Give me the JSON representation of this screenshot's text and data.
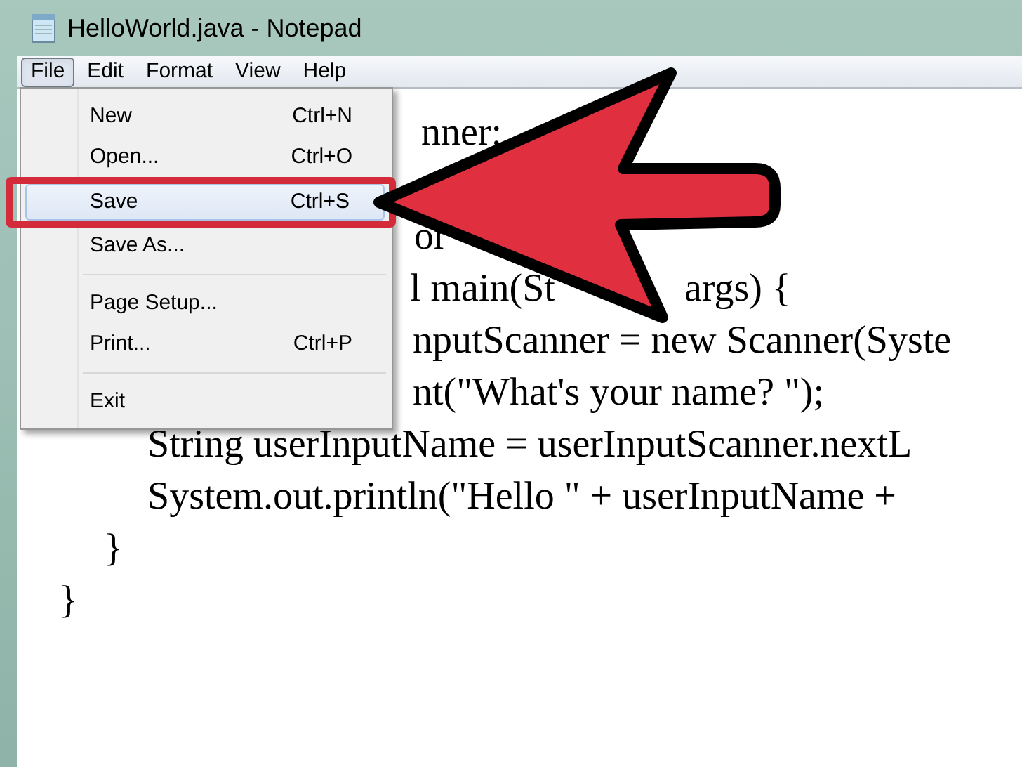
{
  "window": {
    "title": "HelloWorld.java - Notepad"
  },
  "menu_bar": [
    {
      "label": "File",
      "selected": true
    },
    {
      "label": "Edit",
      "selected": false
    },
    {
      "label": "Format",
      "selected": false
    },
    {
      "label": "View",
      "selected": false
    },
    {
      "label": "Help",
      "selected": false
    }
  ],
  "file_menu": [
    {
      "kind": "item",
      "label": "New",
      "shortcut": "Ctrl+N",
      "selected": false
    },
    {
      "kind": "item",
      "label": "Open...",
      "shortcut": "Ctrl+O",
      "selected": false
    },
    {
      "kind": "item",
      "label": "Save",
      "shortcut": "Ctrl+S",
      "selected": true
    },
    {
      "kind": "item",
      "label": "Save As...",
      "selected": false
    },
    {
      "kind": "separator"
    },
    {
      "kind": "item",
      "label": "Page Setup...",
      "selected": false
    },
    {
      "kind": "item",
      "label": "Print...",
      "shortcut": "Ctrl+P",
      "selected": false
    },
    {
      "kind": "separator"
    },
    {
      "kind": "item",
      "label": "Exit",
      "selected": false
    }
  ],
  "code_lines": [
    [
      "nner:"
    ],
    [
      "or"
    ],
    [
      "l main(St",
      "args) {"
    ],
    [
      "nputScanner = new Scanner(Syste"
    ],
    [
      "nt(\"What's your name? \");"
    ],
    [
      "String userInputName = userInputScanner.nextL"
    ],
    [
      "System.out.println(\"Hello \" + userInputName +"
    ],
    [
      "}"
    ],
    [
      "}"
    ]
  ]
}
